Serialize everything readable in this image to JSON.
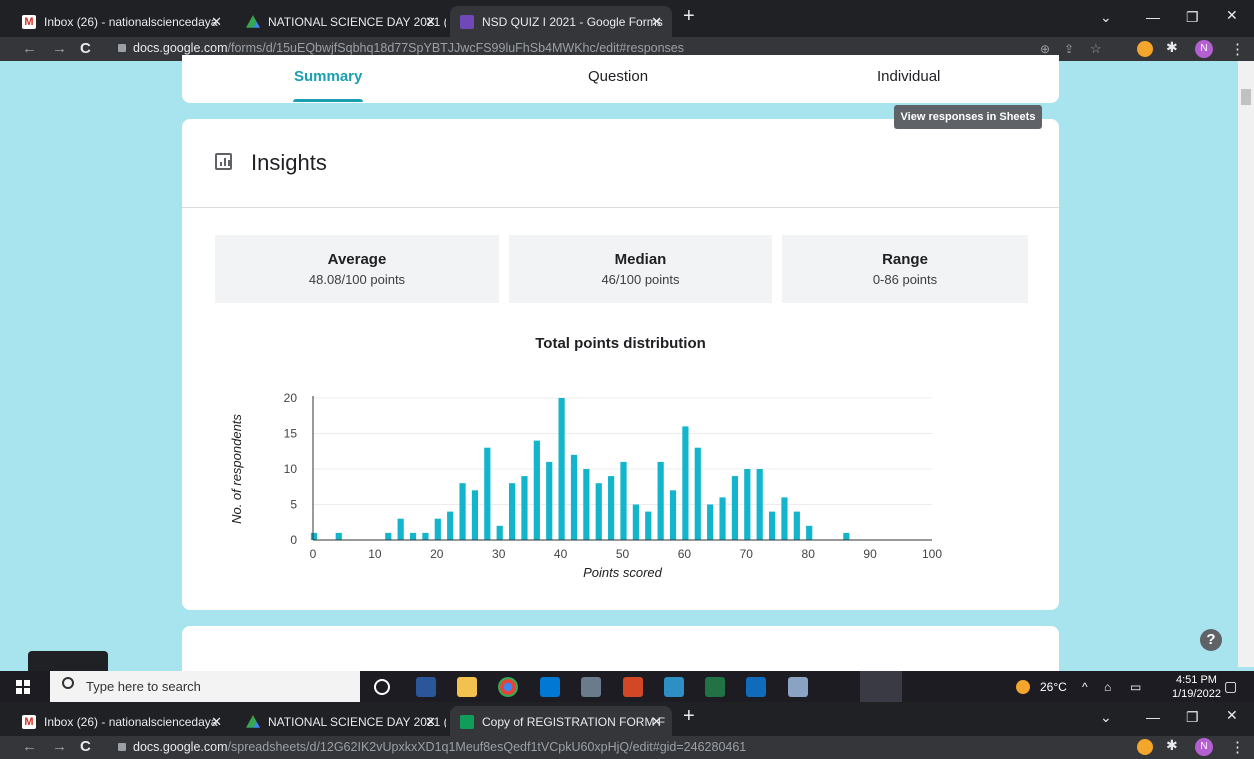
{
  "browser_top": {
    "tabs": [
      {
        "title": "Inbox (26) - nationalsciencedaya",
        "icon": "gmail-icon"
      },
      {
        "title": "NATIONAL SCIENCE DAY 2021 (2",
        "icon": "drive-icon"
      },
      {
        "title": "NSD QUIZ I 2021 - Google Forms",
        "icon": "forms-icon"
      }
    ],
    "url_domain": "docs.google.com",
    "url_path": "/forms/d/15uEQbwjfSqbhq18d77SpYBTJJwcFS99luFhSb4MWKhc/edit#responses",
    "profile_initial": "N"
  },
  "form": {
    "tabs": [
      "Summary",
      "Question",
      "Individual"
    ],
    "tooltip": "View responses in Sheets",
    "insights_title": "Insights",
    "stats": [
      {
        "label": "Average",
        "value": "48.08/100 points"
      },
      {
        "label": "Median",
        "value": "46/100 points"
      },
      {
        "label": "Range",
        "value": "0-86 points"
      }
    ]
  },
  "chart_data": {
    "type": "bar",
    "title": "Total points distribution",
    "xlabel": "Points scored",
    "ylabel": "No. of respondents",
    "xlim": [
      0,
      100
    ],
    "ylim": [
      0,
      20
    ],
    "x_ticks": [
      0,
      10,
      20,
      30,
      40,
      50,
      60,
      70,
      80,
      90,
      100
    ],
    "y_ticks": [
      0,
      5,
      10,
      15,
      20
    ],
    "grid": true,
    "colors": {
      "bar": "#12b5cb"
    },
    "x": [
      0,
      4,
      12,
      14,
      16,
      18,
      20,
      22,
      24,
      26,
      28,
      30,
      32,
      34,
      36,
      38,
      40,
      42,
      44,
      46,
      48,
      50,
      52,
      54,
      56,
      58,
      60,
      62,
      64,
      66,
      68,
      70,
      72,
      74,
      76,
      78,
      80,
      86
    ],
    "values": [
      1,
      1,
      1,
      3,
      1,
      1,
      3,
      4,
      8,
      7,
      13,
      2,
      8,
      9,
      14,
      11,
      20,
      12,
      10,
      8,
      9,
      11,
      5,
      4,
      11,
      7,
      16,
      13,
      5,
      6,
      9,
      10,
      10,
      4,
      6,
      4,
      2,
      1
    ]
  },
  "taskbar": {
    "search_placeholder": "Type here to search",
    "weather": "26°C",
    "time": "4:51 PM",
    "date": "1/19/2022"
  },
  "browser_bottom": {
    "tabs": [
      {
        "title": "Inbox (26) - nationalsciencedaya",
        "icon": "gmail-icon"
      },
      {
        "title": "NATIONAL SCIENCE DAY 2021 (2",
        "icon": "drive-icon"
      },
      {
        "title": "Copy of REGISTRATION FORM F",
        "icon": "sheets-icon"
      }
    ],
    "url_domain": "docs.google.com",
    "url_path": "/spreadsheets/d/12G62IK2vUpxkxXD1q1Meuf8esQedf1tVCpkU60xpHjQ/edit#gid=246280461",
    "profile_initial": "N"
  }
}
